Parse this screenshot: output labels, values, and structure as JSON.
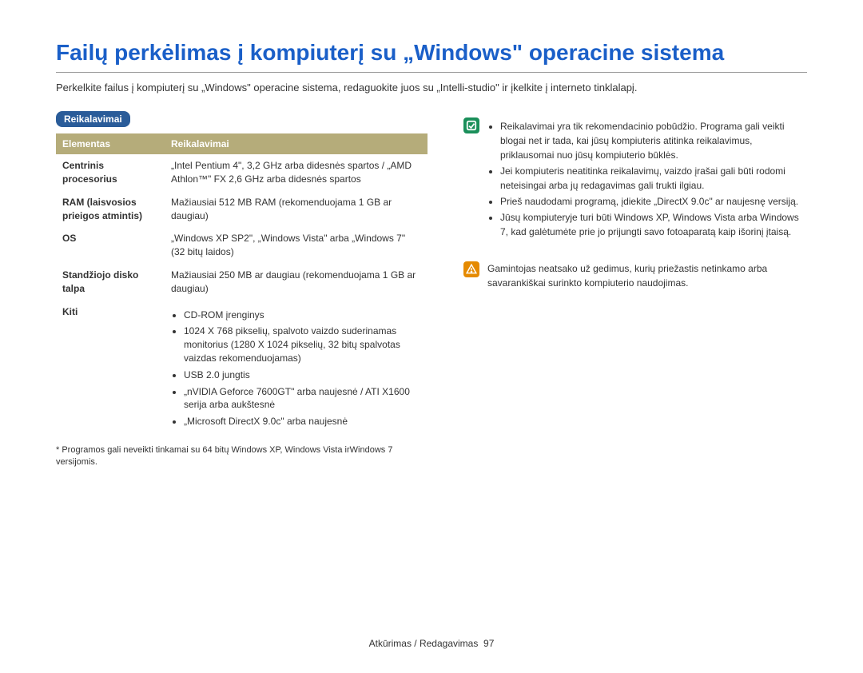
{
  "title": "Failų perkėlimas į kompiuterį su „Windows\" operacine sistema",
  "intro": "Perkelkite failus į kompiuterį su „Windows\" operacine sistema, redaguokite juos su „Intelli-studio\" ir įkelkite į interneto tinklalapį.",
  "section_badge": "Reikalavimai",
  "table": {
    "head": {
      "col1": "Elementas",
      "col2": "Reikalavimai"
    },
    "rows": {
      "cpu": {
        "label": "Centrinis procesorius",
        "value": "„Intel Pentium 4\", 3,2 GHz arba didesnės spartos / „AMD Athlon™\" FX 2,6 GHz arba didesnės spartos"
      },
      "ram": {
        "label": "RAM (laisvosios prieigos atmintis)",
        "value": "Mažiausiai 512 MB RAM (rekomenduojama 1 GB ar daugiau)"
      },
      "os": {
        "label": "OS",
        "value": "„Windows XP SP2\", „Windows Vista\" arba „Windows 7\" (32 bitų laidos)"
      },
      "hdd": {
        "label": "Standžiojo disko talpa",
        "value": "Mažiausiai 250 MB ar daugiau (rekomenduojama 1 GB ar daugiau)"
      },
      "other": {
        "label": "Kiti",
        "items": [
          "CD-ROM įrenginys",
          "1024 X 768 pikselių, spalvoto vaizdo suderinamas monitorius (1280 X 1024 pikselių, 32 bitų spalvotas vaizdas rekomenduojamas)",
          "USB 2.0 jungtis",
          "„nVIDIA Geforce 7600GT\" arba naujesnė / ATI X1600 serija arba aukštesnė",
          "„Microsoft DirectX 9.0c\" arba naujesnė"
        ]
      }
    }
  },
  "footnote": "* Programos gali neveikti tinkamai su 64 bitų Windows XP, Windows Vista irWindows 7 versijomis.",
  "info_note": {
    "items": [
      "Reikalavimai yra tik rekomendacinio pobūdžio. Programa gali veikti blogai net ir tada, kai jūsų kompiuteris atitinka reikalavimus, priklausomai nuo jūsų kompiuterio būklės.",
      "Jei kompiuteris neatitinka reikalavimų, vaizdo įrašai gali būti rodomi neteisingai arba jų redagavimas gali trukti ilgiau.",
      "Prieš naudodami programą, įdiekite „DirectX 9.0c\" ar naujesnę versiją.",
      "Jūsų kompiuteryje turi būti Windows XP, Windows Vista arba Windows 7, kad galėtumėte prie jo prijungti savo fotoaparatą kaip išorinį įtaisą."
    ]
  },
  "warn_note": {
    "text": "Gamintojas neatsako už gedimus, kurių priežastis netinkamo arba savarankiškai surinkto kompiuterio naudojimas."
  },
  "footer": {
    "label": "Atkūrimas / Redagavimas",
    "page": "97"
  }
}
